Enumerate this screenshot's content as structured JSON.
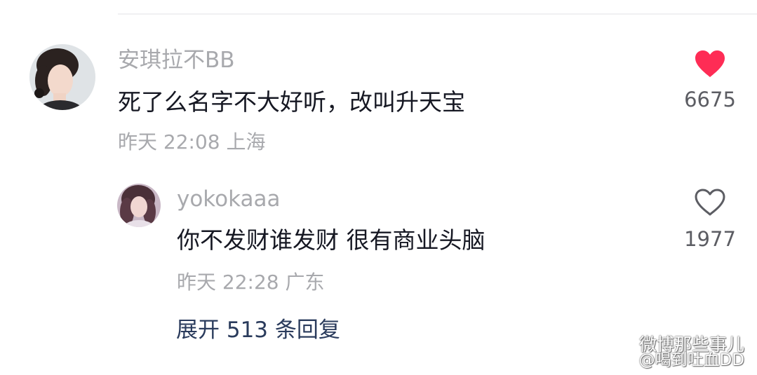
{
  "comment": {
    "username": "安琪拉不BB",
    "text": "死了么名字不大好听，改叫升天宝",
    "time": "昨天 22:08",
    "location": "上海",
    "like_count": "6675",
    "liked": true,
    "like_color": "#fe2c55"
  },
  "reply": {
    "username": "yokokaaa",
    "text": "你不发财谁发财 很有商业头脑",
    "time": "昨天 22:28",
    "location": "广东",
    "like_count": "1977",
    "liked": false
  },
  "expand_replies_label": "展开 513 条回复",
  "watermark": {
    "channel": "微博那些事儿",
    "handle": "@喝到吐血DD",
    "icon": "wechat-icon"
  }
}
